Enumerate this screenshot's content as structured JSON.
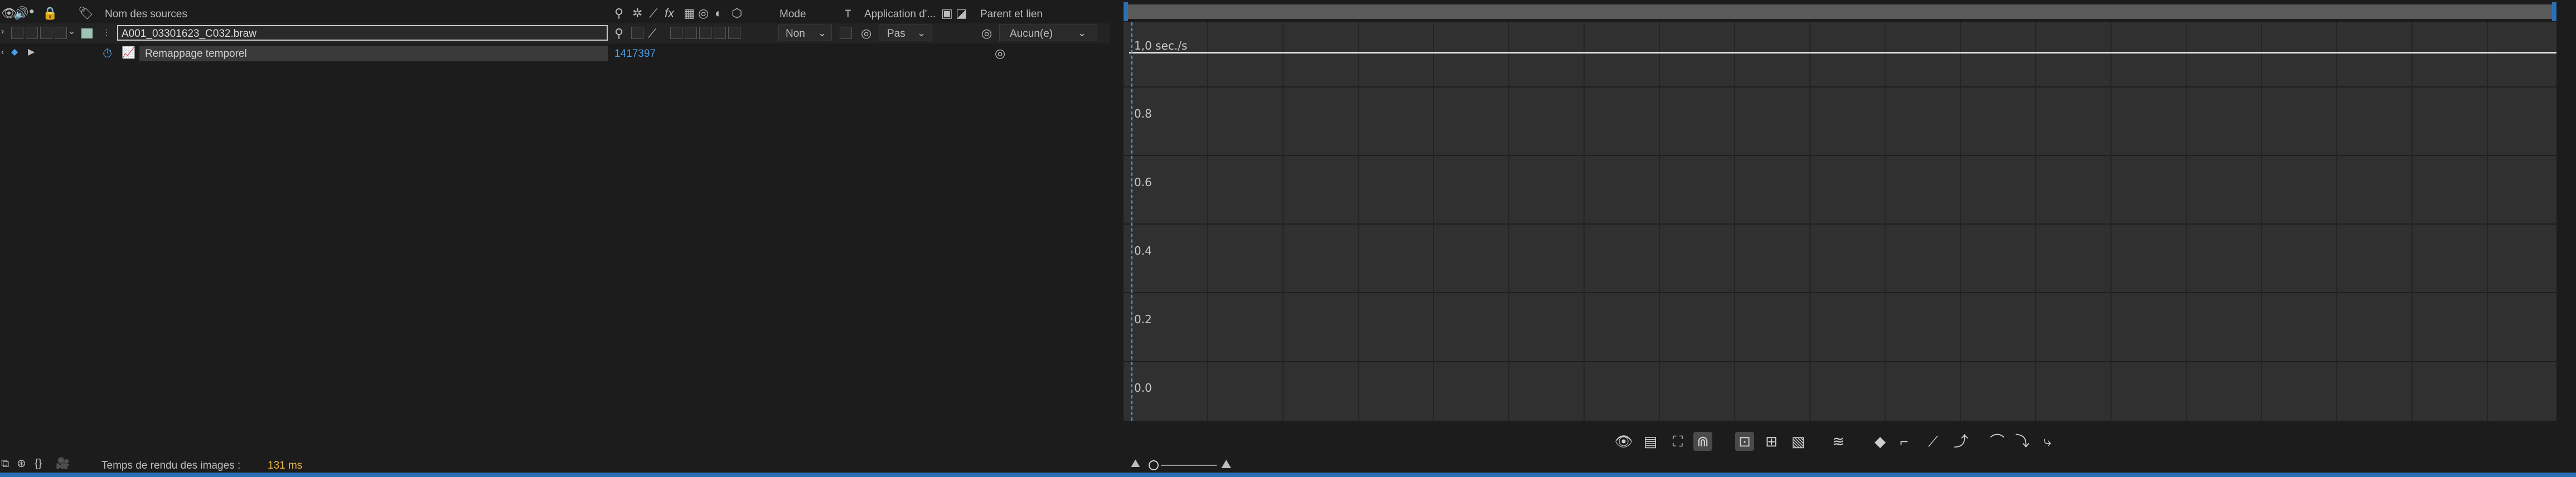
{
  "header": {
    "source_name_col": "Nom des sources",
    "mode_col": "Mode",
    "t_col": "T",
    "track_matte_col": "Application d'...",
    "parent_col": "Parent et lien"
  },
  "layer": {
    "name": "A001_03301623_C032.braw",
    "mode_value": "Non",
    "track_matte_value": "Pas",
    "parent_value": "Aucun(e)"
  },
  "property": {
    "name": "Remappage temporel",
    "value": "1417397"
  },
  "graph": {
    "unit_label": "1,0 sec./s",
    "y_labels": [
      "0.8",
      "0.6",
      "0.4",
      "0.2",
      "0.0"
    ]
  },
  "status": {
    "render_time_label": "Temps de rendu des images :",
    "render_time_value": "131 ms"
  },
  "colors": {
    "accent": "#2b6fb5",
    "link": "#4a9ee8",
    "timing": "#e8b24a",
    "layer_label": "#9fc6b4"
  }
}
